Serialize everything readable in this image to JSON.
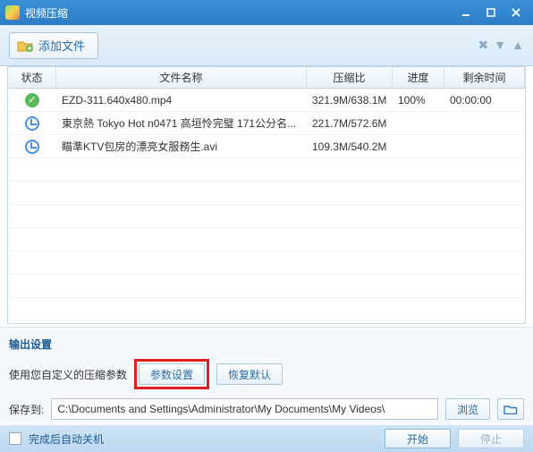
{
  "titlebar": {
    "title": "视频压缩"
  },
  "toolbar": {
    "add_label": "添加文件"
  },
  "table": {
    "headers": {
      "status": "状态",
      "name": "文件名称",
      "ratio": "压缩比",
      "progress": "进度",
      "remain": "剩余时间"
    },
    "rows": [
      {
        "status": "done",
        "name": "EZD-311.640x480.mp4",
        "ratio": "321.9M/638.1M",
        "progress": "100%",
        "remain": "00:00:00"
      },
      {
        "status": "wait",
        "name": "東京熱 Tokyo Hot n0471 高垣怜完璧 171公分名...",
        "ratio": "221.7M/572.6M",
        "progress": "",
        "remain": ""
      },
      {
        "status": "wait",
        "name": "瞄準KTV包房的漂亮女服務生.avi",
        "ratio": "109.3M/540.2M",
        "progress": "",
        "remain": ""
      }
    ]
  },
  "output": {
    "section_title": "输出设置",
    "custom_label": "使用您自定义的压缩参数",
    "param_btn": "参数设置",
    "restore_btn": "恢复默认",
    "save_to_label": "保存到:",
    "path_value": "C:\\Documents and Settings\\Administrator\\My Documents\\My Videos\\",
    "browse_btn": "浏览"
  },
  "bottom": {
    "shutdown_label": "完成后自动关机",
    "start_btn": "开始",
    "stop_btn": "停止"
  }
}
